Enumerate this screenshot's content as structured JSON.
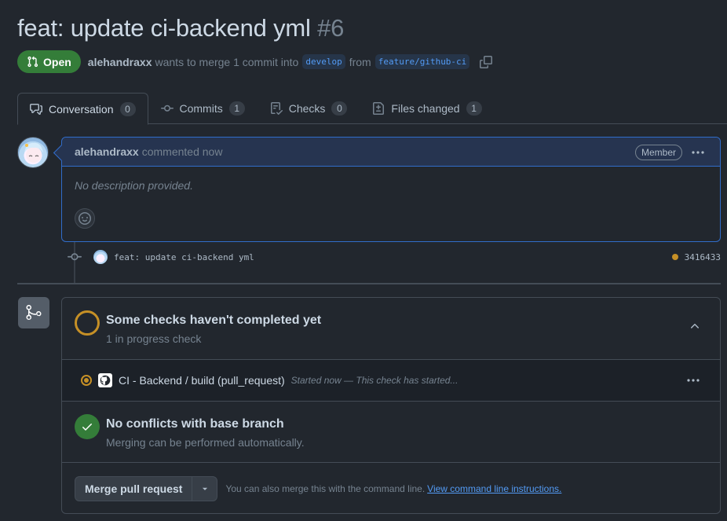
{
  "pr": {
    "title": "feat: update ci-backend yml",
    "number": "#6",
    "state": "Open",
    "author": "alehandraxx",
    "merge_text": "wants to merge 1 commit into",
    "base_branch": "develop",
    "from_text": "from",
    "head_branch": "feature/github-ci"
  },
  "tabs": [
    {
      "label": "Conversation",
      "count": "0",
      "icon": "comment-discussion-icon"
    },
    {
      "label": "Commits",
      "count": "1",
      "icon": "commit-icon"
    },
    {
      "label": "Checks",
      "count": "0",
      "icon": "checklist-icon"
    },
    {
      "label": "Files changed",
      "count": "1",
      "icon": "file-diff-icon"
    }
  ],
  "comment": {
    "author": "alehandraxx",
    "time": "commented now",
    "role": "Member",
    "body": "No description provided."
  },
  "commit": {
    "message": "feat: update ci-backend yml",
    "sha": "3416433"
  },
  "checks": {
    "title": "Some checks haven't completed yet",
    "subtitle": "1 in progress check",
    "item_name": "CI - Backend / build (pull_request)",
    "item_desc": "Started now — This check has started..."
  },
  "conflicts": {
    "title": "No conflicts with base branch",
    "subtitle": "Merging can be performed automatically."
  },
  "merge": {
    "button_label": "Merge pull request",
    "hint": "You can also merge this with the command line.",
    "link": "View command line instructions."
  },
  "colors": {
    "background": "#22272e",
    "open_green": "#347d39",
    "pending": "#c69026",
    "link": "#539bf5",
    "comment_border": "#316dca"
  }
}
